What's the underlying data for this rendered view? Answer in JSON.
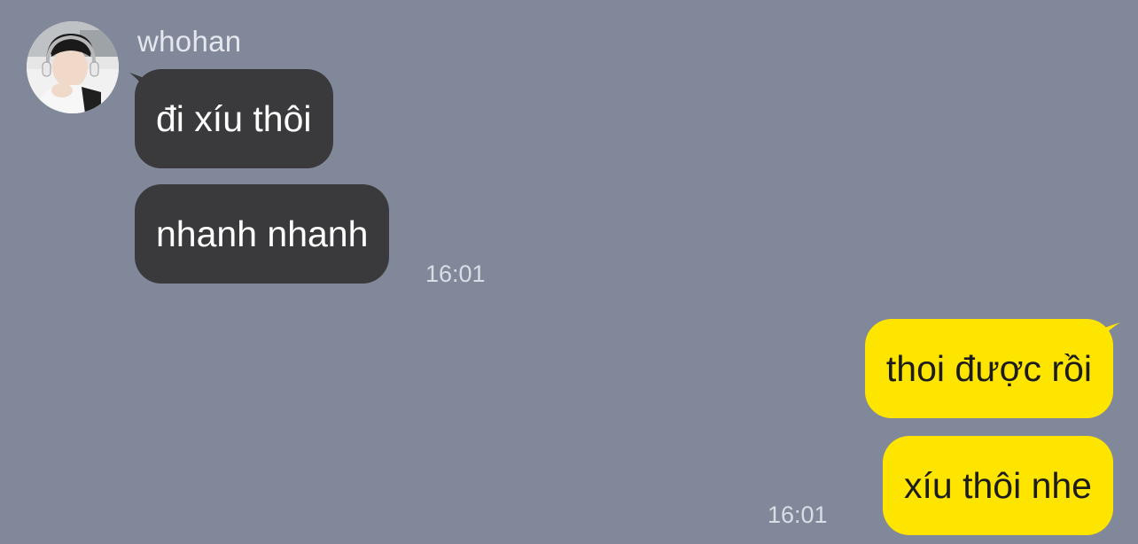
{
  "contact": {
    "name": "whohan"
  },
  "incoming": {
    "messages": [
      {
        "text": "đi xíu thôi"
      },
      {
        "text": "nhanh nhanh"
      }
    ],
    "time": "16:01"
  },
  "outgoing": {
    "messages": [
      {
        "text": "thoi được rồi"
      },
      {
        "text": "xíu thôi nhe"
      }
    ],
    "time": "16:01"
  },
  "colors": {
    "background": "#808899",
    "incoming_bubble": "#3a3a3c",
    "outgoing_bubble": "#fee500"
  }
}
